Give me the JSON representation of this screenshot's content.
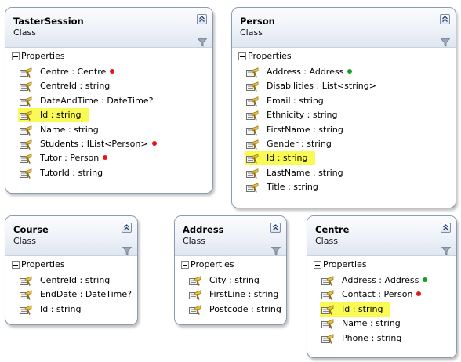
{
  "colors": {
    "dot_red": "#e8141c",
    "dot_green": "#15a01e",
    "highlight": "#fafa55"
  },
  "classes": {
    "taster": {
      "name": "TasterSession",
      "kind": "Class",
      "section": "Properties",
      "props": [
        {
          "text": "Centre : Centre",
          "dot": "red"
        },
        {
          "text": "CentreId : string"
        },
        {
          "text": "DateAndTime : DateTime?"
        },
        {
          "text": "Id : string",
          "highlight": true
        },
        {
          "text": "Name : string"
        },
        {
          "text": "Students : IList<Person>",
          "dot": "red"
        },
        {
          "text": "Tutor : Person",
          "dot": "red"
        },
        {
          "text": "TutorId : string"
        }
      ]
    },
    "person": {
      "name": "Person",
      "kind": "Class",
      "section": "Properties",
      "props": [
        {
          "text": "Address : Address",
          "dot": "green"
        },
        {
          "text": "Disabilities : List<string>"
        },
        {
          "text": "Email : string"
        },
        {
          "text": "Ethnicity : string"
        },
        {
          "text": "FirstName : string"
        },
        {
          "text": "Gender : string"
        },
        {
          "text": "Id : string",
          "highlight": true
        },
        {
          "text": "LastName : string"
        },
        {
          "text": "Title : string"
        }
      ]
    },
    "course": {
      "name": "Course",
      "kind": "Class",
      "section": "Properties",
      "props": [
        {
          "text": "CentreId : string"
        },
        {
          "text": "EndDate : DateTime?"
        },
        {
          "text": "Id : string"
        }
      ]
    },
    "address": {
      "name": "Address",
      "kind": "Class",
      "section": "Properties",
      "props": [
        {
          "text": "City : string"
        },
        {
          "text": "FirstLine : string"
        },
        {
          "text": "Postcode : string"
        }
      ]
    },
    "centre": {
      "name": "Centre",
      "kind": "Class",
      "section": "Properties",
      "props": [
        {
          "text": "Address : Address",
          "dot": "green"
        },
        {
          "text": "Contact : Person",
          "dot": "red"
        },
        {
          "text": "Id : string",
          "highlight": true
        },
        {
          "text": "Name : string"
        },
        {
          "text": "Phone : string"
        }
      ]
    }
  }
}
